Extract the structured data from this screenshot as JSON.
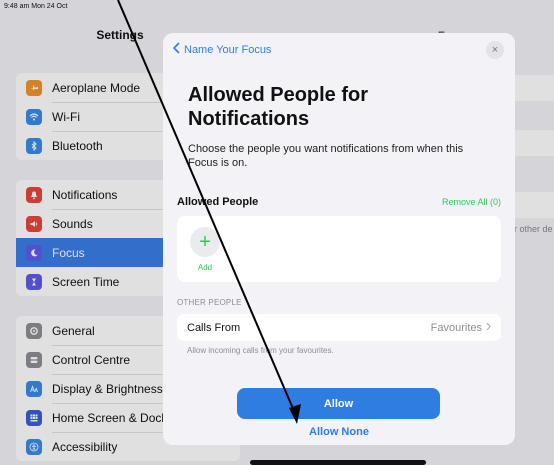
{
  "status_bar": {
    "time_date": "9:48 am  Mon 24 Oct"
  },
  "sidebar": {
    "title": "Settings",
    "groups": [
      [
        {
          "label": "Aeroplane Mode",
          "icon": "airplane-icon",
          "color": "#f0962d"
        },
        {
          "label": "Wi-Fi",
          "icon": "wifi-icon",
          "color": "#3a8be8"
        },
        {
          "label": "Bluetooth",
          "icon": "bluetooth-icon",
          "color": "#3a8be8"
        }
      ],
      [
        {
          "label": "Notifications",
          "icon": "bell-icon",
          "color": "#e9473c"
        },
        {
          "label": "Sounds",
          "icon": "speaker-icon",
          "color": "#e9473c"
        },
        {
          "label": "Focus",
          "icon": "moon-icon",
          "color": "#5e5ce6",
          "active": true
        },
        {
          "label": "Screen Time",
          "icon": "hourglass-icon",
          "color": "#5e5ce6"
        }
      ],
      [
        {
          "label": "General",
          "icon": "gear-icon",
          "color": "#8e8e93"
        },
        {
          "label": "Control Centre",
          "icon": "switches-icon",
          "color": "#8e8e93"
        },
        {
          "label": "Display & Brightness",
          "icon": "text-size-icon",
          "color": "#3a8be8"
        },
        {
          "label": "Home Screen & Dock",
          "icon": "grid-icon",
          "color": "#3a5fd9"
        },
        {
          "label": "Accessibility",
          "icon": "accessibility-icon",
          "color": "#3a8be8"
        }
      ]
    ]
  },
  "detail": {
    "title": "Focus",
    "partial_text": "r other de"
  },
  "modal": {
    "back_label": "Name Your Focus",
    "close_symbol": "×",
    "title": "Allowed People for Notifications",
    "description": "Choose the people you want notifications from when this Focus is on.",
    "allowed_header": "Allowed People",
    "remove_all": "Remove All (0)",
    "add_label": "Add",
    "other_header": "OTHER PEOPLE",
    "calls_label": "Calls From",
    "calls_value": "Favourites",
    "calls_footnote": "Allow incoming calls from your favourites.",
    "allow_button": "Allow",
    "allow_none": "Allow None"
  },
  "colors": {
    "accent_blue": "#2f7de1",
    "green": "#34c759",
    "active_row": "#3a7ee6"
  }
}
